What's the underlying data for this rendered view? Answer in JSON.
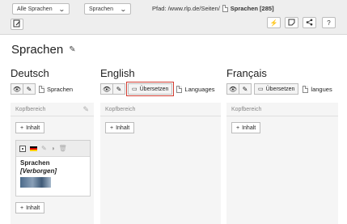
{
  "toolbar": {
    "language_select": "Alle Sprachen",
    "mode_select": "Sprachen",
    "path_label": "Pfad: /www.rlp.de/Seiten/",
    "page_title": "Sprachen [285]"
  },
  "page": {
    "title": "Sprachen"
  },
  "columns": [
    {
      "language": "Deutsch",
      "page_label": "Sprachen",
      "area_label": "Kopfbereich",
      "add_label": "Inhalt"
    },
    {
      "language": "English",
      "translate_label": "Übersetzen",
      "page_label": "Languages",
      "area_label": "Kopfbereich",
      "add_label": "Inhalt"
    },
    {
      "language": "Français",
      "translate_label": "Übersetzen",
      "page_label": "langues",
      "area_label": "Kopfbereich",
      "add_label": "Inhalt"
    }
  ],
  "content_element": {
    "title": "Sprachen",
    "hidden_label": "[Verborgen]"
  },
  "colors": {
    "highlight": "#d03a2f",
    "topbar": "#eeeeee",
    "column_bg": "#f5f5f5"
  }
}
